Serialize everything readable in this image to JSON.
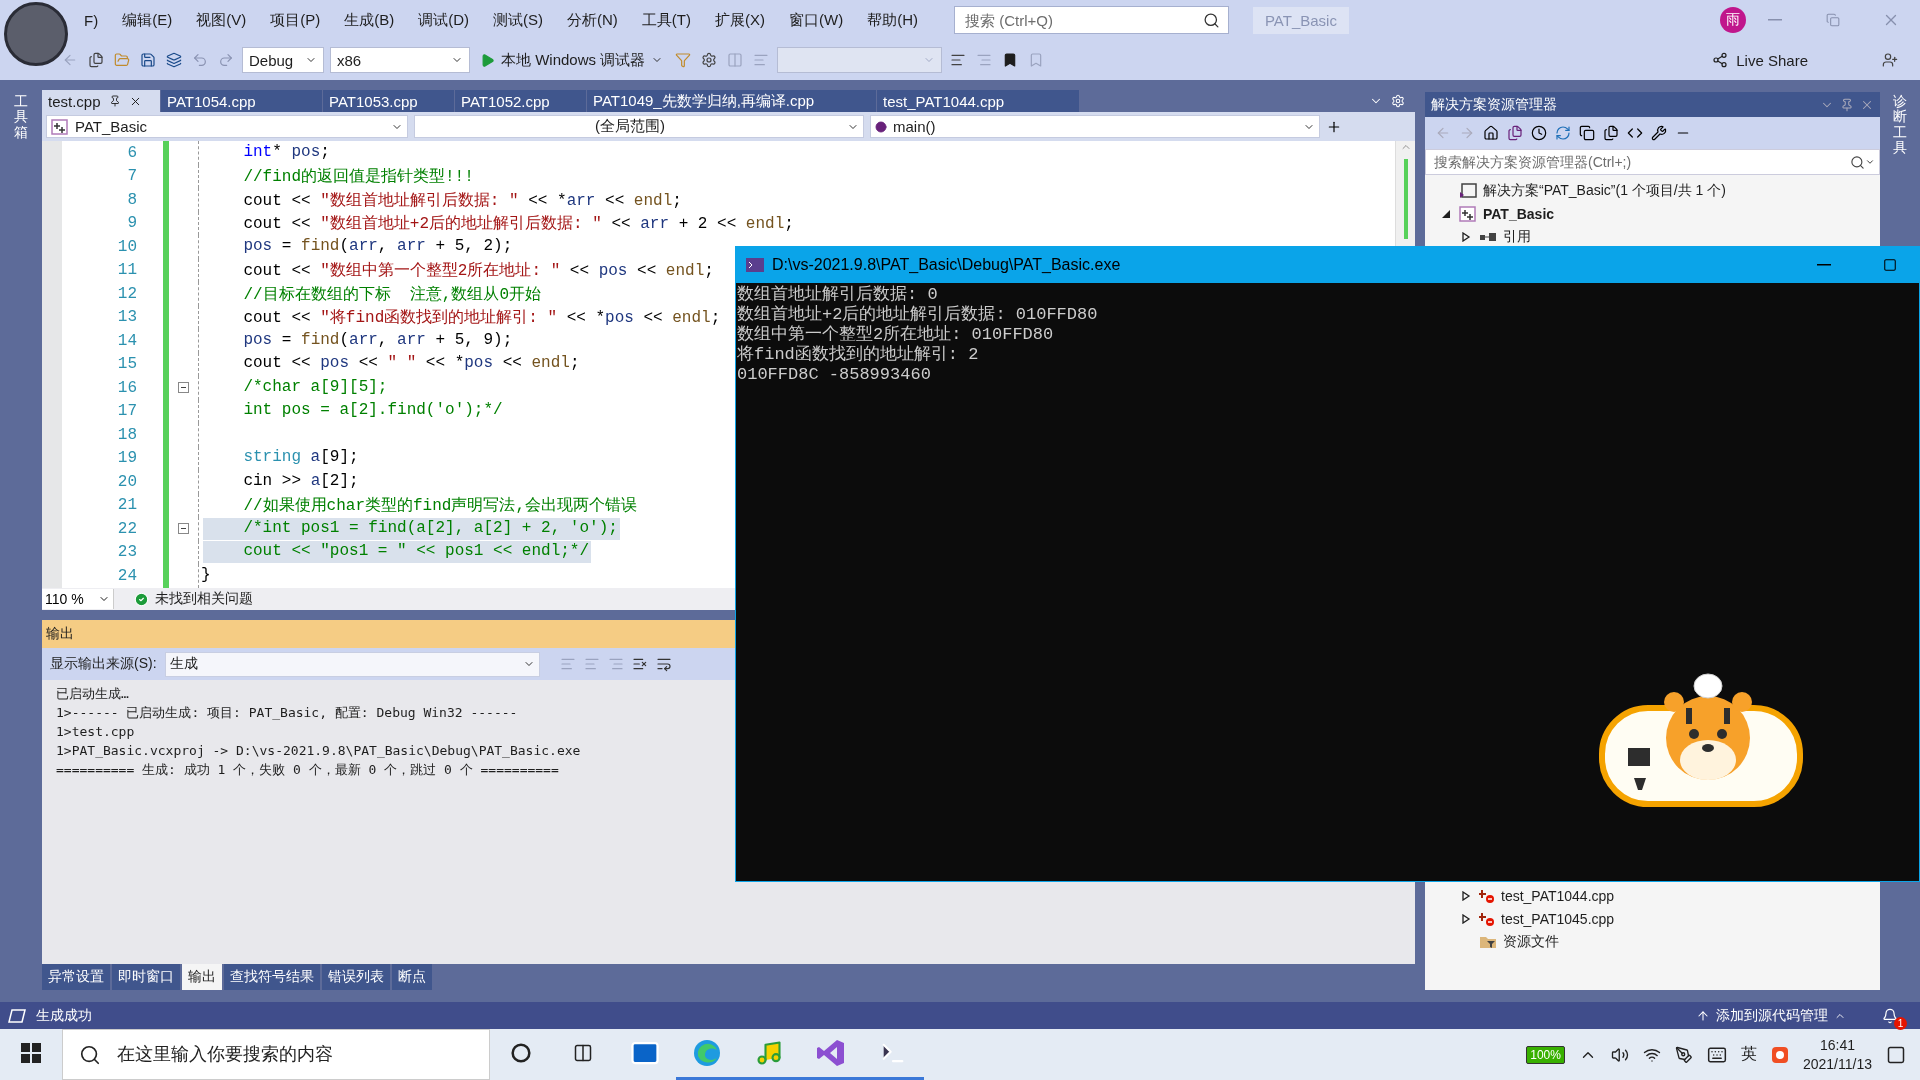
{
  "menu": {
    "items": [
      "F)",
      "编辑(E)",
      "视图(V)",
      "项目(P)",
      "生成(B)",
      "调试(D)",
      "测试(S)",
      "分析(N)",
      "工具(T)",
      "扩展(X)",
      "窗口(W)",
      "帮助(H)"
    ],
    "search": {
      "placeholder": "搜索 (Ctrl+Q)"
    },
    "solution_name": "PAT_Basic",
    "user_initial": "雨"
  },
  "toolbar": {
    "configuration": "Debug",
    "platform": "x86",
    "run_label": "本地 Windows 调试器",
    "live_share": "Live Share"
  },
  "left_strip": "工具箱",
  "right_strip": "诊断工具",
  "doc_tabs": [
    {
      "label": "test.cpp",
      "selected": true
    },
    {
      "label": "PAT1054.cpp",
      "selected": false
    },
    {
      "label": "PAT1053.cpp",
      "selected": false
    },
    {
      "label": "PAT1052.cpp",
      "selected": false
    },
    {
      "label": "PAT1049_先数学归纳,再编译.cpp",
      "selected": false
    },
    {
      "label": "test_PAT1044.cpp",
      "selected": false
    }
  ],
  "nav_bar": {
    "project": "PAT_Basic",
    "scope": "(全局范围)",
    "member": "main()"
  },
  "code": {
    "lines": [
      {
        "number": "6",
        "selected": false,
        "fold": false,
        "tokens": [
          {
            "kind": "kw",
            "text": "    int"
          },
          {
            "kind": "tx",
            "text": "* "
          },
          {
            "kind": "var",
            "text": "pos"
          },
          {
            "kind": "tx",
            "text": ";"
          }
        ]
      },
      {
        "number": "7",
        "selected": false,
        "fold": false,
        "tokens": [
          {
            "kind": "cm",
            "text": "    //find的返回值是指针类型!!!"
          }
        ]
      },
      {
        "number": "8",
        "selected": false,
        "fold": false,
        "tokens": [
          {
            "kind": "tx",
            "text": "    cout << "
          },
          {
            "kind": "str",
            "text": "\"数组首地址解引后数据: \""
          },
          {
            "kind": "tx",
            "text": " << *"
          },
          {
            "kind": "var",
            "text": "arr"
          },
          {
            "kind": "tx",
            "text": " << "
          },
          {
            "kind": "fn",
            "text": "endl"
          },
          {
            "kind": "tx",
            "text": ";"
          }
        ]
      },
      {
        "number": "9",
        "selected": false,
        "fold": false,
        "tokens": [
          {
            "kind": "tx",
            "text": "    cout << "
          },
          {
            "kind": "str",
            "text": "\"数组首地址+2后的地址解引后数据: \""
          },
          {
            "kind": "tx",
            "text": " << "
          },
          {
            "kind": "var",
            "text": "arr"
          },
          {
            "kind": "tx",
            "text": " + 2 << "
          },
          {
            "kind": "fn",
            "text": "endl"
          },
          {
            "kind": "tx",
            "text": ";"
          }
        ]
      },
      {
        "number": "10",
        "selected": false,
        "fold": false,
        "tokens": [
          {
            "kind": "var",
            "text": "    pos"
          },
          {
            "kind": "tx",
            "text": " = "
          },
          {
            "kind": "fn",
            "text": "find"
          },
          {
            "kind": "tx",
            "text": "("
          },
          {
            "kind": "var",
            "text": "arr"
          },
          {
            "kind": "tx",
            "text": ", "
          },
          {
            "kind": "var",
            "text": "arr"
          },
          {
            "kind": "tx",
            "text": " + 5, 2);"
          }
        ]
      },
      {
        "number": "11",
        "selected": false,
        "fold": false,
        "tokens": [
          {
            "kind": "tx",
            "text": "    cout << "
          },
          {
            "kind": "str",
            "text": "\"数组中第一个整型2所在地址: \""
          },
          {
            "kind": "tx",
            "text": " << "
          },
          {
            "kind": "var",
            "text": "pos"
          },
          {
            "kind": "tx",
            "text": " << "
          },
          {
            "kind": "fn",
            "text": "endl"
          },
          {
            "kind": "tx",
            "text": ";"
          }
        ]
      },
      {
        "number": "12",
        "selected": false,
        "fold": false,
        "tokens": [
          {
            "kind": "cm",
            "text": "    //目标在数组的下标  注意,数组从0开始"
          }
        ]
      },
      {
        "number": "13",
        "selected": false,
        "fold": false,
        "tokens": [
          {
            "kind": "tx",
            "text": "    cout << "
          },
          {
            "kind": "str",
            "text": "\"将find函数找到的地址解引: \""
          },
          {
            "kind": "tx",
            "text": " << *"
          },
          {
            "kind": "var",
            "text": "pos"
          },
          {
            "kind": "tx",
            "text": " << "
          },
          {
            "kind": "fn",
            "text": "endl"
          },
          {
            "kind": "tx",
            "text": ";"
          }
        ]
      },
      {
        "number": "14",
        "selected": false,
        "fold": false,
        "tokens": [
          {
            "kind": "var",
            "text": "    pos"
          },
          {
            "kind": "tx",
            "text": " = "
          },
          {
            "kind": "fn",
            "text": "find"
          },
          {
            "kind": "tx",
            "text": "("
          },
          {
            "kind": "var",
            "text": "arr"
          },
          {
            "kind": "tx",
            "text": ", "
          },
          {
            "kind": "var",
            "text": "arr"
          },
          {
            "kind": "tx",
            "text": " + 5, 9);"
          }
        ]
      },
      {
        "number": "15",
        "selected": false,
        "fold": false,
        "tokens": [
          {
            "kind": "tx",
            "text": "    cout << "
          },
          {
            "kind": "var",
            "text": "pos"
          },
          {
            "kind": "tx",
            "text": " << "
          },
          {
            "kind": "str",
            "text": "\" \""
          },
          {
            "kind": "tx",
            "text": " << *"
          },
          {
            "kind": "var",
            "text": "pos"
          },
          {
            "kind": "tx",
            "text": " << "
          },
          {
            "kind": "fn",
            "text": "endl"
          },
          {
            "kind": "tx",
            "text": ";"
          }
        ]
      },
      {
        "number": "16",
        "selected": false,
        "fold": true,
        "tokens": [
          {
            "kind": "cm",
            "text": "    /*char a[9][5];"
          }
        ]
      },
      {
        "number": "17",
        "selected": false,
        "fold": false,
        "tokens": [
          {
            "kind": "cm",
            "text": "    int pos = a[2].find('o');*/"
          }
        ]
      },
      {
        "number": "18",
        "selected": false,
        "fold": false
      },
      {
        "number": "19",
        "selected": false,
        "fold": false,
        "tokens": [
          {
            "kind": "type",
            "text": "    string"
          },
          {
            "kind": "var",
            "text": " a"
          },
          {
            "kind": "tx",
            "text": "[9];"
          }
        ]
      },
      {
        "number": "20",
        "selected": false,
        "fold": false,
        "tokens": [
          {
            "kind": "tx",
            "text": "    cin >> "
          },
          {
            "kind": "var",
            "text": "a"
          },
          {
            "kind": "tx",
            "text": "[2];"
          }
        ]
      },
      {
        "number": "21",
        "selected": false,
        "fold": false,
        "tokens": [
          {
            "kind": "cm",
            "text": "    //如果使用char类型的find声明写法,会出现两个错误"
          }
        ]
      },
      {
        "number": "22",
        "selected": true,
        "fold": true,
        "tokens": [
          {
            "kind": "cm",
            "text": "    /*int pos1 = find(a[2], a[2] + 2, 'o');"
          }
        ]
      },
      {
        "number": "23",
        "selected": true,
        "fold": false,
        "tokens": [
          {
            "kind": "cm",
            "text": "    cout << \"pos1 = \" << pos1 << endl;*/"
          }
        ]
      },
      {
        "number": "24",
        "selected": false,
        "fold": false,
        "tokens": [
          {
            "kind": "tx",
            "text": "}"
          }
        ]
      }
    ]
  },
  "editor_status": {
    "zoom": "110 %",
    "issues": "未找到相关问题"
  },
  "output": {
    "title": "输出",
    "source_label": "显示输出来源(S):",
    "source": "生成",
    "lines": [
      "已启动生成…",
      "1>------ 已启动生成: 项目: PAT_Basic, 配置: Debug Win32 ------",
      "1>test.cpp",
      "1>PAT_Basic.vcxproj -> D:\\vs-2021.9.8\\PAT_Basic\\Debug\\PAT_Basic.exe",
      "========== 生成: 成功 1 个，失败 0 个，最新 0 个，跳过 0 个 =========="
    ],
    "tabs": [
      {
        "label": "异常设置",
        "selected": false
      },
      {
        "label": "即时窗口",
        "selected": false
      },
      {
        "label": "输出",
        "selected": true
      },
      {
        "label": "查找符号结果",
        "selected": false
      },
      {
        "label": "错误列表",
        "selected": false
      },
      {
        "label": "断点",
        "selected": false
      }
    ]
  },
  "solution_explorer": {
    "title": "解决方案资源管理器",
    "search_placeholder": "搜索解决方案资源管理器(Ctrl+;)",
    "tree": [
      {
        "kind": "solution",
        "label": "解决方案“PAT_Basic”(1 个项目/共 1 个)",
        "children": [
          {
            "kind": "project",
            "label": "PAT_Basic",
            "expanded": true,
            "children": [
              {
                "kind": "references",
                "label": "引用",
                "expanded": false
              },
              {
                "kind": "file",
                "label": "test_PAT1044.cpp",
                "expanded": false
              },
              {
                "kind": "file",
                "label": "test_PAT1045.cpp",
                "expanded": false
              },
              {
                "kind": "folder",
                "label": "资源文件"
              }
            ]
          }
        ]
      }
    ]
  },
  "status_bar": {
    "message": "生成成功",
    "source_control": "添加到源代码管理",
    "notifications": "1"
  },
  "taskbar": {
    "search_placeholder": "在这里输入你要搜索的内容",
    "battery": "100%",
    "ime": "英",
    "time": "16:41",
    "date": "2021/11/13"
  },
  "console": {
    "title": "D:\\vs-2021.9.8\\PAT_Basic\\Debug\\PAT_Basic.exe",
    "lines": [
      "数组首地址解引后数据: 0",
      "数组首地址+2后的地址解引后数据: 010FFD80",
      "数组中第一个整型2所在地址: 010FFD80",
      "将find函数找到的地址解引: 2",
      "010FFD8C -858993460"
    ]
  }
}
